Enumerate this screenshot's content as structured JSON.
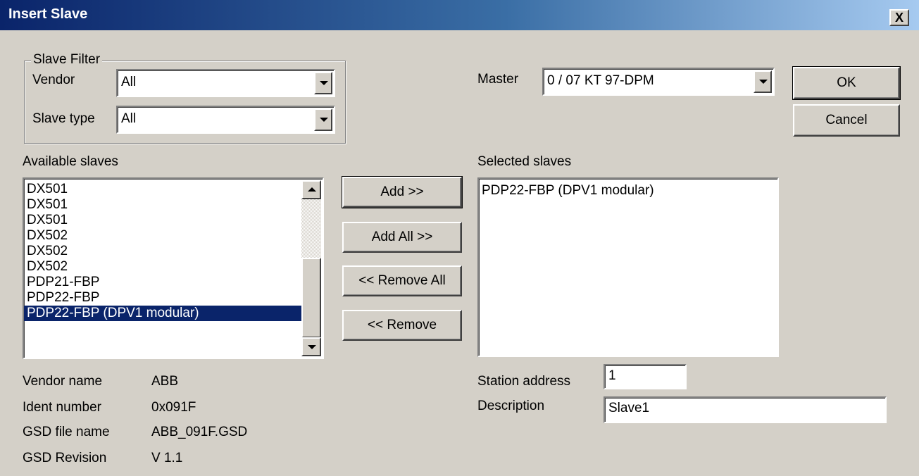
{
  "window": {
    "title": "Insert Slave",
    "close_label": "X"
  },
  "filter": {
    "group_title": "Slave Filter",
    "vendor_label": "Vendor",
    "vendor_value": "All",
    "slave_type_label": "Slave type",
    "slave_type_value": "All"
  },
  "master": {
    "label": "Master",
    "value": "0 / 07 KT 97-DPM"
  },
  "buttons": {
    "ok": "OK",
    "cancel": "Cancel",
    "add": "Add >>",
    "add_all": "Add All >>",
    "remove_all": "<< Remove All",
    "remove": "<< Remove"
  },
  "available": {
    "label": "Available slaves",
    "items": [
      "DX501",
      "DX501",
      "DX501",
      "DX502",
      "DX502",
      "DX502",
      "PDP21-FBP",
      "PDP22-FBP",
      "PDP22-FBP (DPV1 modular)"
    ],
    "selected_index": 8
  },
  "selected": {
    "label": "Selected slaves",
    "items": [
      "PDP22-FBP (DPV1 modular)"
    ]
  },
  "info": {
    "vendor_name_label": "Vendor name",
    "vendor_name_value": "ABB",
    "ident_label": "Ident number",
    "ident_value": "0x091F",
    "gsd_file_label": "GSD file name",
    "gsd_file_value": "ABB_091F.GSD",
    "gsd_rev_label": "GSD Revision",
    "gsd_rev_value": "V 1.1"
  },
  "station": {
    "address_label": "Station address",
    "address_value": "1",
    "description_label": "Description",
    "description_value": "Slave1"
  },
  "colors": {
    "titlebar_start": "#0a246a",
    "titlebar_end": "#a6caf0",
    "face": "#d4d0c8",
    "selection": "#0a246a"
  }
}
